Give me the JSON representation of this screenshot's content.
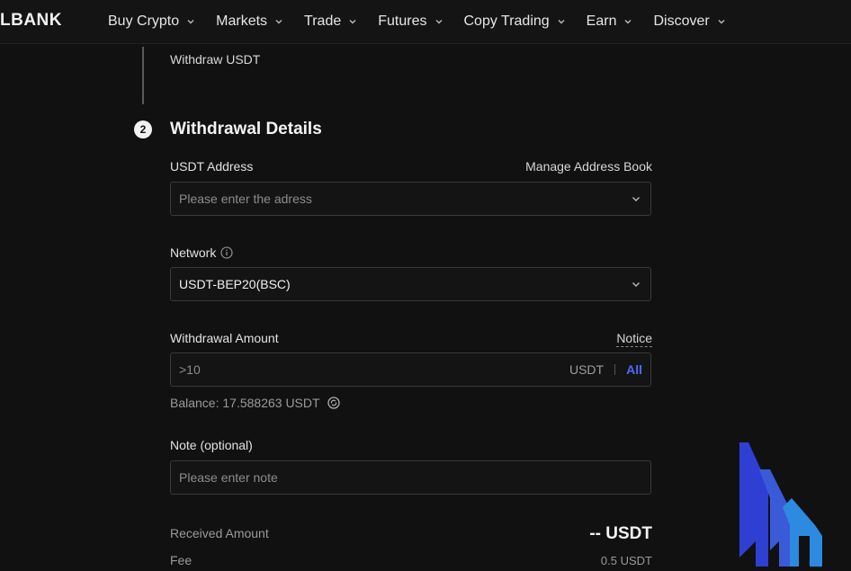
{
  "brand": {
    "logo_text": "LBANK"
  },
  "nav": {
    "items": [
      {
        "label": "Buy Crypto"
      },
      {
        "label": "Markets"
      },
      {
        "label": "Trade"
      },
      {
        "label": "Futures"
      },
      {
        "label": "Copy Trading"
      },
      {
        "label": "Earn"
      },
      {
        "label": "Discover"
      }
    ]
  },
  "steps": {
    "step1_label": "Withdraw USDT",
    "step2_number": "2",
    "step2_title": "Withdrawal Details"
  },
  "address": {
    "label": "USDT Address",
    "manage_link": "Manage Address Book",
    "placeholder": "Please enter the adress"
  },
  "network": {
    "label": "Network",
    "info_icon": "info-icon",
    "selected": "USDT-BEP20(BSC)"
  },
  "amount": {
    "label": "Withdrawal Amount",
    "notice_link": "Notice",
    "placeholder": ">10",
    "unit": "USDT",
    "all_label": "All",
    "balance_text": "Balance: 17.588263 USDT"
  },
  "note": {
    "label": "Note (optional)",
    "placeholder": "Please enter note"
  },
  "summary": {
    "received_label": "Received Amount",
    "received_value": "-- USDT",
    "fee_label": "Fee",
    "fee_value": "0.5 USDT"
  },
  "colors": {
    "accent": "#4c6bff",
    "background": "#111111"
  }
}
